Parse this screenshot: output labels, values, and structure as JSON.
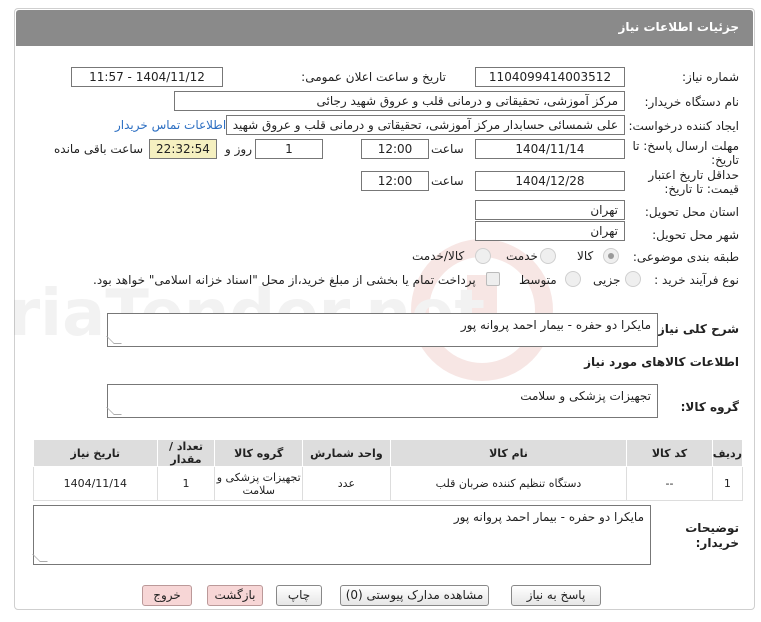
{
  "header": {
    "title": "جزئیات اطلاعات نیاز"
  },
  "fields": {
    "need_number_label": "شماره نیاز:",
    "need_number": "1104099414003512",
    "announce_label": "تاریخ و ساعت اعلان عمومی:",
    "announce_value": "1404/11/12 - 11:57",
    "buyer_label": "نام دستگاه خریدار:",
    "buyer_value": "مرکز آموزشی، تحقیقاتی و درمانی قلب و عروق شهید رجائی",
    "requester_label": "ایجاد کننده درخواست:",
    "requester_value": "علی شمسائی حسابدار مرکز آموزشی، تحقیقاتی و درمانی قلب و عروق شهید",
    "contact_link": "اطلاعات تماس خریدار",
    "reply_deadline_label_1": "مهلت ارسال پاسخ: تا",
    "reply_deadline_label_2": "تاریخ:",
    "reply_date": "1404/11/14",
    "time_label": "ساعت",
    "reply_time": "12:00",
    "days_value": "1",
    "days_label": "روز و",
    "remaining_time": "22:32:54",
    "remaining_label": "ساعت باقی مانده",
    "validity_label_1": "حداقل تاریخ اعتبار",
    "validity_label_2": "قیمت: تا تاریخ:",
    "validity_date": "1404/12/28",
    "validity_time": "12:00",
    "province_label": "استان محل تحویل:",
    "province_value": "تهران",
    "city_label": "شهر محل تحویل:",
    "city_value": "تهران",
    "category_label": "طبقه بندی موضوعی:",
    "category_options": [
      "کالا",
      "خدمت",
      "کالا/خدمت"
    ],
    "category_selected": "کالا",
    "process_label": "نوع فرآیند خرید :",
    "process_options": [
      "جزیی",
      "متوسط"
    ],
    "process_note": "پرداخت تمام یا بخشی از مبلغ خرید،از محل \"اسناد خزانه اسلامی\" خواهد بود."
  },
  "summary": {
    "label": "شرح کلی نیاز:",
    "value": "مایکرا دو حفره - بیمار احمد پروانه پور"
  },
  "goods_section_title": "اطلاعات کالاهای مورد نیاز",
  "goods_group": {
    "label": "گروه کالا:",
    "value": "تجهیزات پزشکی و سلامت"
  },
  "table": {
    "headers": [
      "ردیف",
      "کد کالا",
      "نام کالا",
      "واحد شمارش",
      "گروه کالا",
      "تعداد / مقدار",
      "تاریخ نیاز"
    ],
    "rows": [
      [
        "1",
        "--",
        "دستگاه تنظیم کننده ضربان قلب",
        "عدد",
        "تجهیزات پزشکی و سلامت",
        "1",
        "1404/11/14"
      ]
    ]
  },
  "buyer_notes": {
    "label_1": "توضیحات",
    "label_2": "خریدار:",
    "value": "مایکرا دو حفره - بیمار احمد پروانه پور"
  },
  "buttons": {
    "reply": "پاسخ به نیاز",
    "attachments": "مشاهده مدارک پیوستی (0)",
    "print": "چاپ",
    "back": "بازگشت",
    "exit": "خروج"
  },
  "watermark": "AriaTender.net"
}
